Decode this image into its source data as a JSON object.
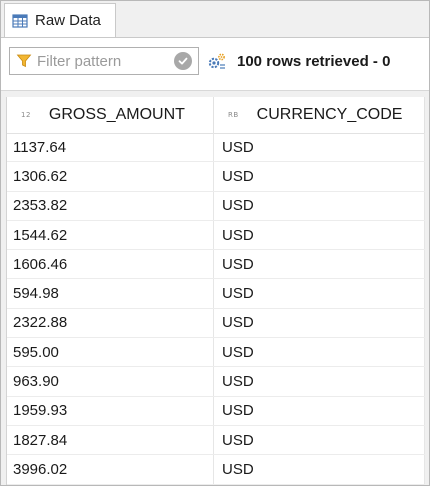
{
  "tab": {
    "label": "Raw Data",
    "icon": "table-grid-icon"
  },
  "toolbar": {
    "filter_placeholder": "Filter pattern",
    "filter_value": "",
    "filter_icon": "funnel-icon",
    "clear_icon": "clear-check-icon",
    "refine_icon": "refine-gear-icon",
    "status": "100 rows retrieved - 0"
  },
  "grid": {
    "columns": [
      {
        "type_badge": "12",
        "label": "GROSS_AMOUNT"
      },
      {
        "type_badge": "RB",
        "label": "CURRENCY_CODE"
      }
    ],
    "rows": [
      [
        "1137.64",
        "USD"
      ],
      [
        "1306.62",
        "USD"
      ],
      [
        "2353.82",
        "USD"
      ],
      [
        "1544.62",
        "USD"
      ],
      [
        "1606.46",
        "USD"
      ],
      [
        "594.98",
        "USD"
      ],
      [
        "2322.88",
        "USD"
      ],
      [
        "595.00",
        "USD"
      ],
      [
        "963.90",
        "USD"
      ],
      [
        "1959.93",
        "USD"
      ],
      [
        "1827.84",
        "USD"
      ],
      [
        "3996.02",
        "USD"
      ]
    ]
  },
  "colors": {
    "accent_orange": "#e8a021",
    "grid_icon_blue": "#4a7ab8"
  }
}
